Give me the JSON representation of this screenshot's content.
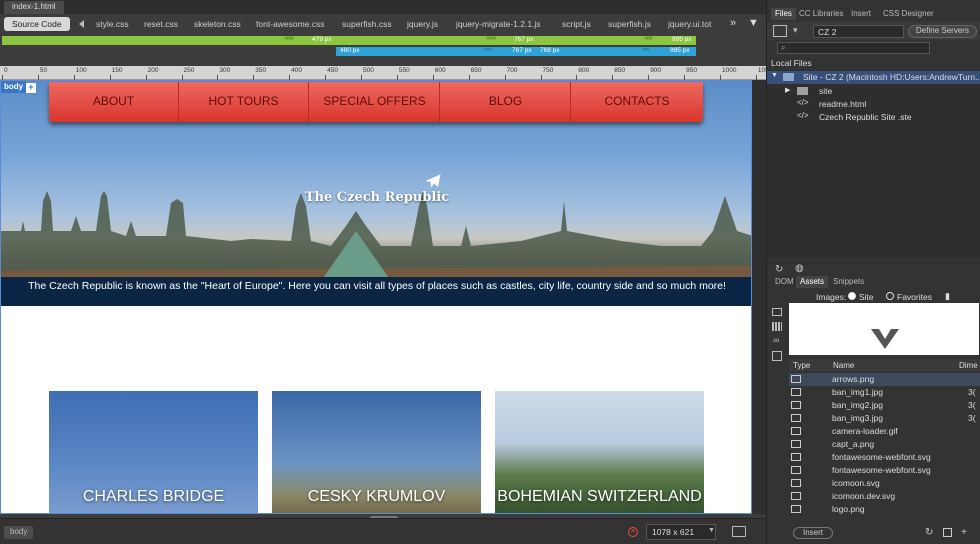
{
  "document": {
    "tab": "index-1.html",
    "source_code_label": "Source Code",
    "related_files": [
      "style.css",
      "reset.css",
      "skeleton.css",
      "font-awesome.css",
      "superfish.css",
      "jquery.js",
      "jquery-migrate-1.2.1.js",
      "script.js",
      "superfish.js",
      "jquery.ui.tot"
    ]
  },
  "media_queries": {
    "green": [
      "479 px",
      "767 px",
      "995 px"
    ],
    "blue": [
      "480 px",
      "767 px",
      "768 px",
      "995 px"
    ]
  },
  "ruler": {
    "ticks": [
      "0",
      "50",
      "100",
      "150",
      "200",
      "250",
      "300",
      "350",
      "400",
      "450",
      "500",
      "550",
      "600",
      "650",
      "700",
      "750",
      "800",
      "850",
      "900",
      "950",
      "1000",
      "1050"
    ]
  },
  "design": {
    "body_tag": "body",
    "plus": "+",
    "nav": [
      "ABOUT",
      "HOT TOURS",
      "SPECIAL OFFERS",
      "BLOG",
      "CONTACTS"
    ],
    "hero_title": "The Czech Republic",
    "caption": "The Czech Republic is known as the \"Heart of Europe\". Here you can visit all types of places such as castles, city life, country side and so much more!",
    "cards": [
      "CHARLES BRIDGE",
      "CESKY KRUMLOV",
      "BOHEMIAN SWITZERLAND"
    ]
  },
  "status": {
    "breadcrumb": "body",
    "size": "1078 x 621"
  },
  "panels": {
    "top_tabs": [
      "Files",
      "CC Libraries",
      "Insert",
      "CSS Designer"
    ],
    "site": "CZ 2",
    "define_servers": "Define Servers",
    "local_files": "Local Files",
    "tree": [
      {
        "label": "Site - CZ 2 (Macintosh HD:Users:AndrewTurn...",
        "kind": "site"
      },
      {
        "label": "site",
        "kind": "folder"
      },
      {
        "label": "readme.html",
        "kind": "file"
      },
      {
        "label": "Czech  Republic Site .ste",
        "kind": "file"
      }
    ],
    "bottom_tabs": [
      "DOM",
      "Assets",
      "Snippets"
    ],
    "images_label": "Images:",
    "site_radio": "Site",
    "favorites_radio": "Favorites",
    "columns": [
      "Type",
      "Name",
      "Dime"
    ],
    "assets": [
      {
        "name": "arrows.png",
        "dim": ""
      },
      {
        "name": "ban_img1.jpg",
        "dim": "3("
      },
      {
        "name": "ban_img2.jpg",
        "dim": "3("
      },
      {
        "name": "ban_img3.jpg",
        "dim": "3("
      },
      {
        "name": "camera-loader.gif",
        "dim": ""
      },
      {
        "name": "capt_a.png",
        "dim": ""
      },
      {
        "name": "fontawesome-webfont.svg",
        "dim": ""
      },
      {
        "name": "fontawesome-webfont.svg",
        "dim": ""
      },
      {
        "name": "icomoon.svg",
        "dim": ""
      },
      {
        "name": "icomoon.dev.svg",
        "dim": ""
      },
      {
        "name": "logo.png",
        "dim": ""
      }
    ],
    "insert_label": "Insert"
  },
  "colors": {
    "nav_red": "#d8352d",
    "caption_navy": "#0b2545",
    "mq_green": "#8cc63e",
    "mq_blue": "#2fa3d6"
  }
}
